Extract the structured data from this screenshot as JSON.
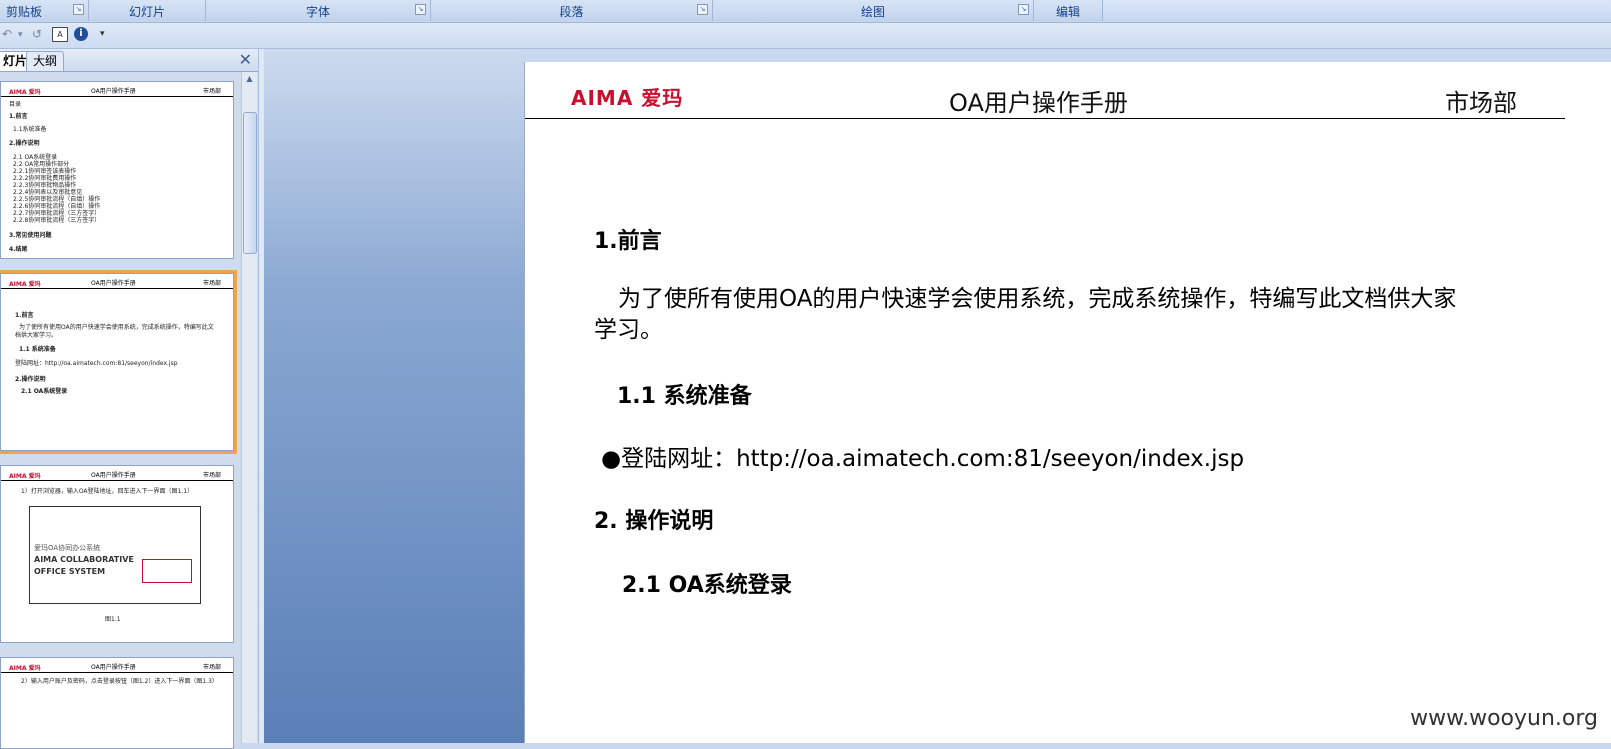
{
  "ribbon": {
    "groups": [
      "剪贴板",
      "幻灯片",
      "字体",
      "段落",
      "绘图",
      "编辑"
    ]
  },
  "qat": {
    "icons": [
      "undo-icon",
      "redo-icon",
      "shape-icon",
      "info-icon",
      "dropdown-icon"
    ]
  },
  "pane": {
    "tabs": [
      "灯片",
      "大纲"
    ],
    "close": "✕",
    "slides": [
      {
        "header_logo": "AIMA 爱玛",
        "header_title": "OA用户操作手册",
        "header_dept": "市场部",
        "lines": [
          "目录",
          "1.前言",
          "1.1系统准备",
          "2.操作说明",
          "2.1 OA系统登录",
          "2.2 OA常用操作部分",
          "2.2.1协同审签该表操作",
          "2.2.2协同审批费用操作",
          "2.2.3协同审批物品操作",
          "2.2.4协同表以及审批意见",
          "2.2.5协同审批流程（自填）操作",
          "2.2.6协同审批流程（自填）操作",
          "2.2.7协同审批流程（三方签字）",
          "2.2.8协同审批流程（三方签字）",
          "3.常见使用问题",
          "4.结尾"
        ]
      },
      {
        "header_logo": "AIMA 爱玛",
        "header_title": "OA用户操作手册",
        "header_dept": "市场部",
        "lines": [
          "1.前言",
          "为了使所有使用OA的用户快速学会使用系统，完成系统操作，特编写此文",
          "档供大家学习。",
          "1.1 系统准备",
          "登陆网址：http://oa.aimatech.com:81/seeyon/index.jsp",
          "2.操作说明",
          "2.1 OA系统登录"
        ]
      },
      {
        "header_logo": "AIMA 爱玛",
        "header_title": "OA用户操作手册",
        "header_dept": "市场部",
        "lines": [
          "1）打开浏览器，输入OA登陆地址，回车进入下一界面（图1.1）",
          "爱玛OA协同办公系统",
          "AIMA COLLABORATIVE",
          "OFFICE SYSTEM",
          "图1.1"
        ]
      },
      {
        "header_logo": "AIMA 爱玛",
        "header_title": "OA用户操作手册",
        "header_dept": "市场部",
        "lines": [
          "2）输入用户账户及密码，点击登录按钮（图1.2）进入下一界面（图1.3）"
        ]
      }
    ]
  },
  "main": {
    "brand": "AIMA 爱玛",
    "title": "OA用户操作手册",
    "dept": "市场部",
    "h1": "1.前言",
    "para": "为了使所有使用OA的用户快速学会使用系统，完成系统操作，特编写此文档供大家学习。",
    "h2a": "1.1 系统准备",
    "bullet": "●登陆网址：http://oa.aimatech.com:81/seeyon/index.jsp",
    "h2b": "2. 操作说明",
    "h3": "2.1 OA系统登录"
  },
  "watermark": "www.wooyun.org"
}
